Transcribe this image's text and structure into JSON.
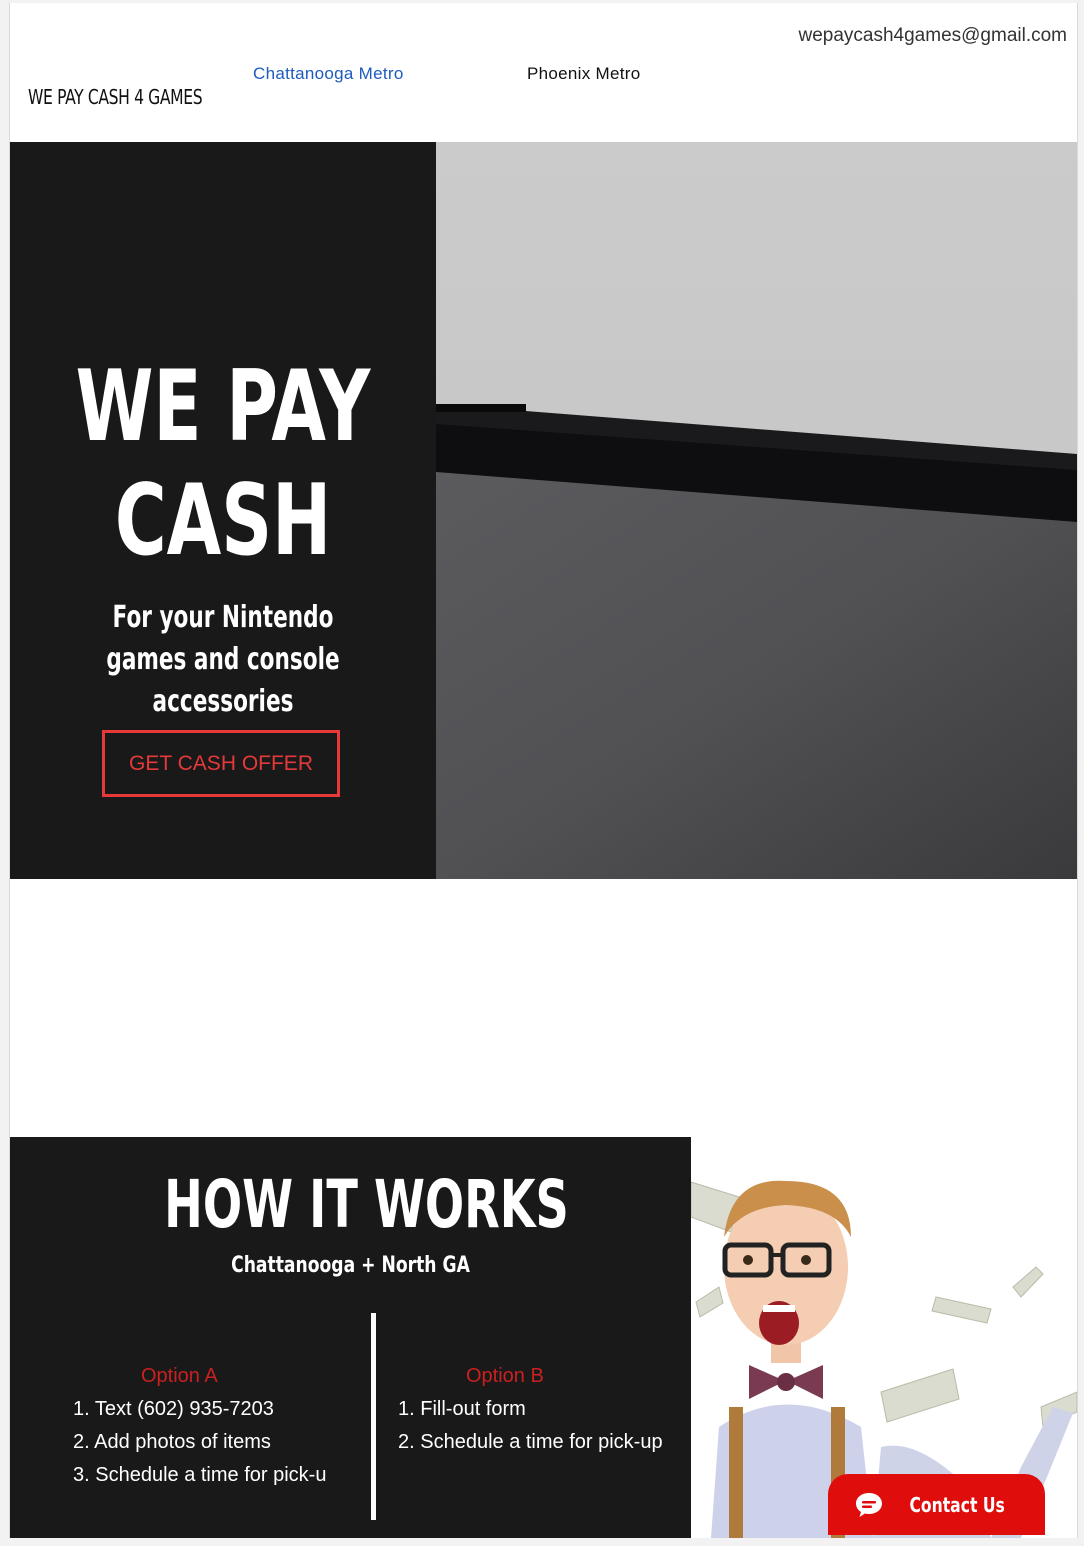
{
  "header": {
    "email": "wepaycash4games@gmail.com",
    "logo_text": "WE PAY CASH 4 GAMES",
    "nav": [
      {
        "label": "Chattanooga Metro",
        "active": true
      },
      {
        "label": "Phoenix Metro",
        "active": false
      }
    ]
  },
  "hero": {
    "title_line1": "WE PAY",
    "title_line2": "CASH",
    "subtitle": "For your Nintendo games and console accessories",
    "cta_label": "GET CASH OFFER",
    "cta_color": "#e5393a",
    "image": "nintendo-console-closeup"
  },
  "how": {
    "title": "HOW IT WORKS",
    "region": "Chattanooga + North GA",
    "option_a": {
      "title": "Option A",
      "steps": [
        "1. Text  (602) 935-7203",
        "2. Add photos of items",
        "3. Schedule a time for pick-u"
      ]
    },
    "option_b": {
      "title": "Option B",
      "steps": [
        "1. Fill-out form",
        "2. Schedule a time for pick-up"
      ]
    },
    "image": "excited-boy-with-flying-money"
  },
  "contact_widget": {
    "label": "Contact Us",
    "icon": "chat-bubble-icon",
    "color": "#e00d0d"
  },
  "colors": {
    "dark_panel": "#19191a",
    "link_blue": "#1d5bbf",
    "option_red": "#c92020"
  }
}
